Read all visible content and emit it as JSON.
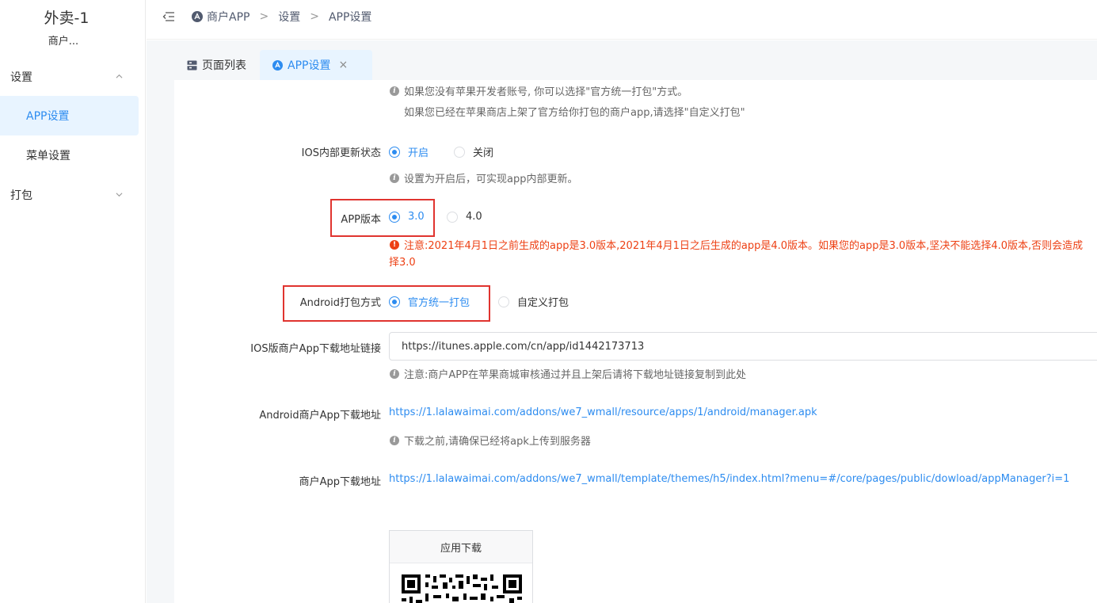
{
  "sidebar": {
    "app_title": "外卖-1",
    "app_subtitle": "商户...",
    "groups": [
      {
        "label": "设置",
        "expanded": true
      },
      {
        "label": "打包",
        "expanded": false
      }
    ],
    "items": [
      {
        "label": "APP设置",
        "active": true
      },
      {
        "label": "菜单设置",
        "active": false
      }
    ]
  },
  "header": {
    "breadcrumb": [
      "商户APP",
      "设置",
      "APP设置"
    ],
    "separator": ">"
  },
  "tabs": [
    {
      "label": "页面列表",
      "icon": "page-list-icon",
      "active": false
    },
    {
      "label": "APP设置",
      "icon": "app-logo-icon",
      "active": true,
      "close": "×"
    }
  ],
  "form": {
    "top_hint_1": "如果您没有苹果开发者账号, 你可以选择\"官方统一打包\"方式。",
    "top_hint_2": "如果您已经在苹果商店上架了官方给你打包的商户app,请选择\"自定义打包\"",
    "ios_update": {
      "label": "IOS内部更新状态",
      "options": [
        "开启",
        "关闭"
      ],
      "selected": "开启",
      "hint": "设置为开启后，可实现app内部更新。"
    },
    "app_version": {
      "label": "APP版本",
      "options": [
        "3.0",
        "4.0"
      ],
      "selected": "3.0",
      "warning_1": "注意:2021年4月1日之前生成的app是3.0版本,2021年4月1日之后生成的app是4.0版本。如果您的app是3.0版本,坚决不能选择4.0版本,否则会造成",
      "warning_2": "择3.0"
    },
    "android_pack": {
      "label": "Android打包方式",
      "options": [
        "官方统一打包",
        "自定义打包"
      ],
      "selected": "官方统一打包"
    },
    "ios_download": {
      "label": "IOS版商户App下载地址链接",
      "value": "https://itunes.apple.com/cn/app/id1442173713",
      "hint": "注意:商户APP在苹果商城审核通过并且上架后请将下载地址链接复制到此处"
    },
    "android_download": {
      "label": "Android商户App下载地址",
      "url": "https://1.lalawaimai.com/addons/we7_wmall/resource/apps/1/android/manager.apk",
      "hint": "下载之前,请确保已经将apk上传到服务器"
    },
    "merchant_download": {
      "label": "商户App下载地址",
      "url": "https://1.lalawaimai.com/addons/we7_wmall/template/themes/h5/index.html?menu=#/core/pages/public/dowload/appManager?i=1"
    },
    "qr_card": {
      "title": "应用下载"
    }
  },
  "colors": {
    "primary": "#2d8cf0",
    "warning": "#ed4014",
    "highlight_box": "#e0342f"
  }
}
